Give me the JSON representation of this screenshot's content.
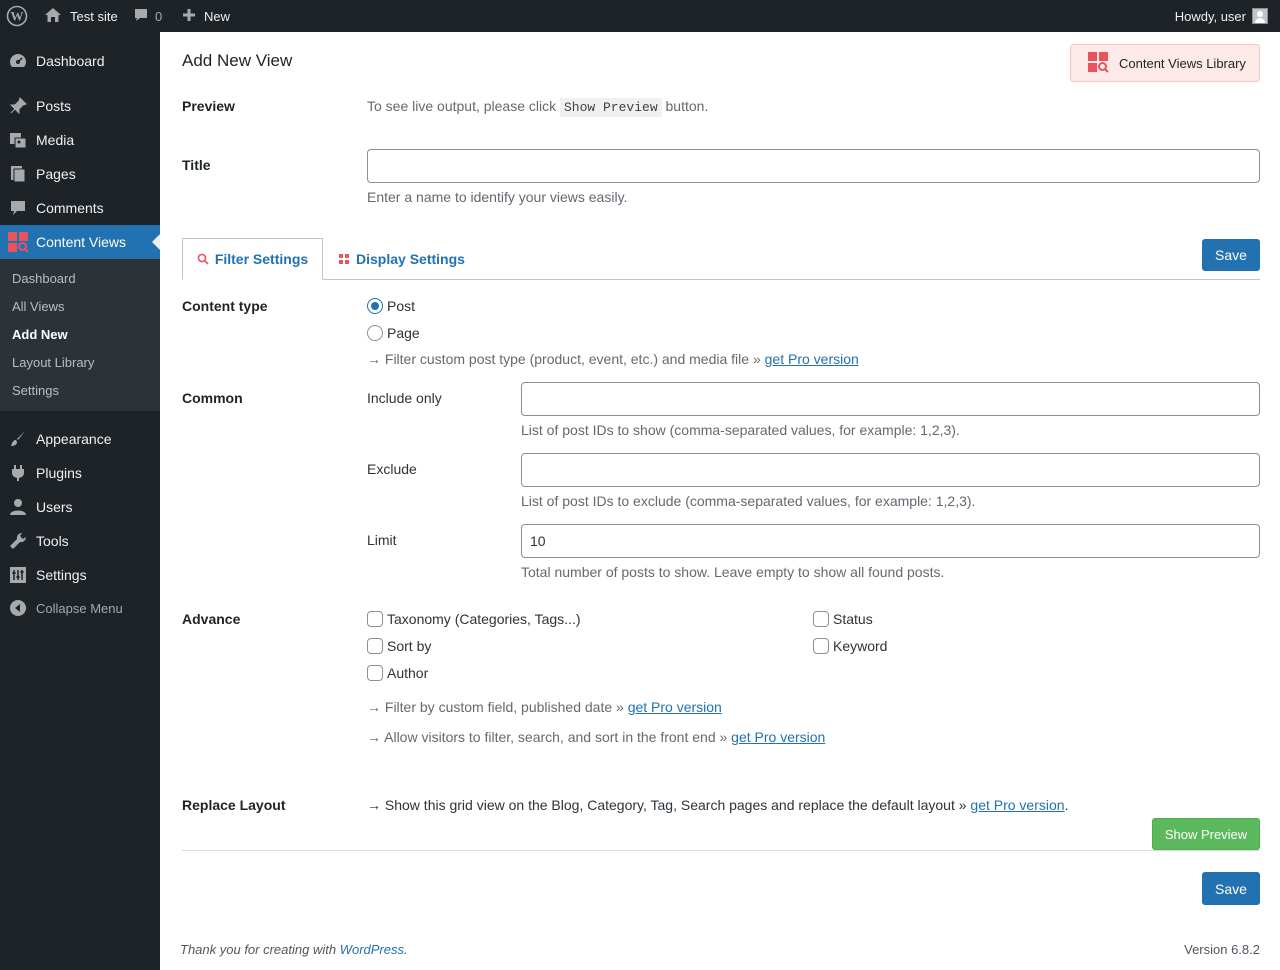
{
  "adminbar": {
    "site_name": "Test site",
    "comments_count": "0",
    "new_label": "New",
    "howdy": "Howdy, user"
  },
  "sidebar": {
    "items": [
      {
        "label": "Dashboard",
        "icon": "dashboard-icon"
      },
      {
        "label": "Posts",
        "icon": "pin-icon"
      },
      {
        "label": "Media",
        "icon": "media-icon"
      },
      {
        "label": "Pages",
        "icon": "pages-icon"
      },
      {
        "label": "Comments",
        "icon": "comment-icon"
      },
      {
        "label": "Content Views",
        "icon": "content-views-icon"
      },
      {
        "label": "Appearance",
        "icon": "brush-icon"
      },
      {
        "label": "Plugins",
        "icon": "plugin-icon"
      },
      {
        "label": "Users",
        "icon": "user-icon"
      },
      {
        "label": "Tools",
        "icon": "wrench-icon"
      },
      {
        "label": "Settings",
        "icon": "settings-icon"
      }
    ],
    "submenu": [
      "Dashboard",
      "All Views",
      "Add New",
      "Layout Library",
      "Settings"
    ],
    "collapse": "Collapse Menu"
  },
  "page": {
    "title": "Add New View",
    "library_button": "Content Views Library",
    "preview_label": "Preview",
    "preview_text_before": "To see live output, please click",
    "preview_code": "Show Preview",
    "preview_text_after": "button.",
    "title_label": "Title",
    "title_value": "",
    "title_desc": "Enter a name to identify your views easily."
  },
  "tabs": {
    "filter": "Filter Settings",
    "display": "Display Settings",
    "save": "Save"
  },
  "content_type": {
    "label": "Content type",
    "options": [
      "Post",
      "Page"
    ],
    "selected": "Post",
    "pro_note": "→ Filter custom post type (product, event, etc.) and media file »",
    "pro_link": "get Pro version"
  },
  "common": {
    "label": "Common",
    "include_label": "Include only",
    "include_value": "",
    "include_desc": "List of post IDs to show (comma-separated values, for example: 1,2,3).",
    "exclude_label": "Exclude",
    "exclude_value": "",
    "exclude_desc": "List of post IDs to exclude (comma-separated values, for example: 1,2,3).",
    "limit_label": "Limit",
    "limit_value": "10",
    "limit_desc": "Total number of posts to show. Leave empty to show all found posts."
  },
  "advance": {
    "label": "Advance",
    "taxonomy": "Taxonomy (Categories, Tags...)",
    "status": "Status",
    "sort_by": "Sort by",
    "keyword": "Keyword",
    "author": "Author",
    "note1": "→ Filter by custom field, published date »",
    "note2": "→ Allow visitors to filter, search, and sort in the front end »",
    "pro_link": "get Pro version"
  },
  "replace_layout": {
    "label": "Replace Layout",
    "text": "→ Show this grid view on the Blog, Category, Tag, Search pages and replace the default layout »",
    "pro_link": "get Pro version",
    "period": "."
  },
  "actions": {
    "show_preview": "Show Preview",
    "save": "Save"
  },
  "footer": {
    "thanks_before": "Thank you for creating with",
    "wordpress": "WordPress",
    "thanks_after": ".",
    "version": "Version 6.8.2"
  },
  "colors": {
    "admin_dark": "#1d2327",
    "primary_blue": "#2271b1",
    "green": "#5cb85c",
    "brand_red": "#e9535b"
  }
}
